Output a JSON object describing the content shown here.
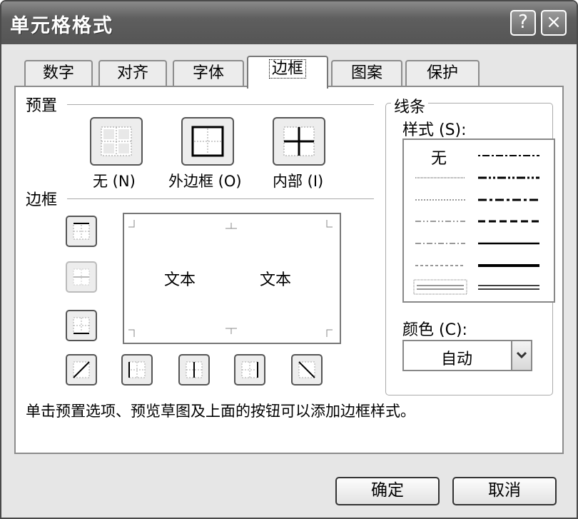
{
  "window": {
    "title": "单元格格式",
    "help_glyph": "?",
    "close_glyph": "×"
  },
  "tabs": [
    {
      "label": "数字"
    },
    {
      "label": "对齐"
    },
    {
      "label": "字体"
    },
    {
      "label": "边框",
      "active": true
    },
    {
      "label": "图案"
    },
    {
      "label": "保护"
    }
  ],
  "presets": {
    "heading": "预置",
    "items": [
      {
        "label": "无 (N)"
      },
      {
        "label": "外边框 (O)"
      },
      {
        "label": "内部 (I)"
      }
    ]
  },
  "border": {
    "heading": "边框",
    "preview_text": [
      "文本",
      "文本"
    ],
    "buttons": [
      "top-border",
      "inside-horizontal-border",
      "bottom-border",
      "diagonal-up-border",
      "left-border",
      "inside-vertical-border",
      "right-border",
      "diagonal-down-border"
    ]
  },
  "hint": "单击预置选项、预览草图及上面的按钮可以添加边框样式。",
  "line": {
    "heading": "线条",
    "style_label": "样式 (S):",
    "none_label": "无",
    "color_label": "颜色 (C):",
    "color_value": "自动"
  },
  "footer": {
    "ok_label": "确定",
    "cancel_label": "取消"
  }
}
